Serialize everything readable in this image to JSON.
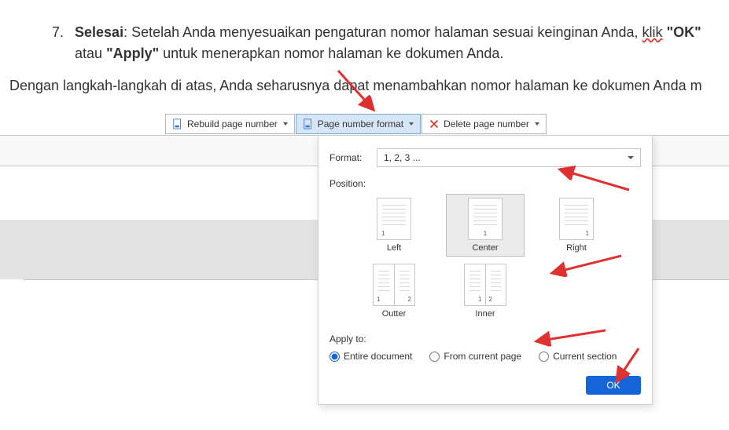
{
  "doc": {
    "list_num": "7.",
    "step_title": "Selesai",
    "step_text_1": ": Setelah Anda menyesuaikan pengaturan nomor halaman sesuai keinginan Anda, ",
    "klik": "klik",
    "ok_bold": "\"OK\"",
    "atau": " atau ",
    "apply_bold": "\"Apply\"",
    "step_text_2": " untuk menerapkan nomor halaman ke dokumen Anda.",
    "para2": "Dengan langkah-langkah di atas, Anda seharusnya dapat menambahkan nomor halaman ke dokumen Anda m"
  },
  "toolbar": {
    "rebuild": "Rebuild page number",
    "format": "Page number format",
    "delete": "Delete page number"
  },
  "popup": {
    "format_label": "Format:",
    "format_value": "1, 2, 3 ...",
    "position_label": "Position:",
    "pos_left": "Left",
    "pos_center": "Center",
    "pos_right": "Right",
    "pos_outter": "Outter",
    "pos_inner": "Inner",
    "apply_label": "Apply to:",
    "radio_entire": "Entire document",
    "radio_current": "From current page",
    "radio_section": "Current section",
    "ok": "OK",
    "n1": "1",
    "n2": "2"
  }
}
